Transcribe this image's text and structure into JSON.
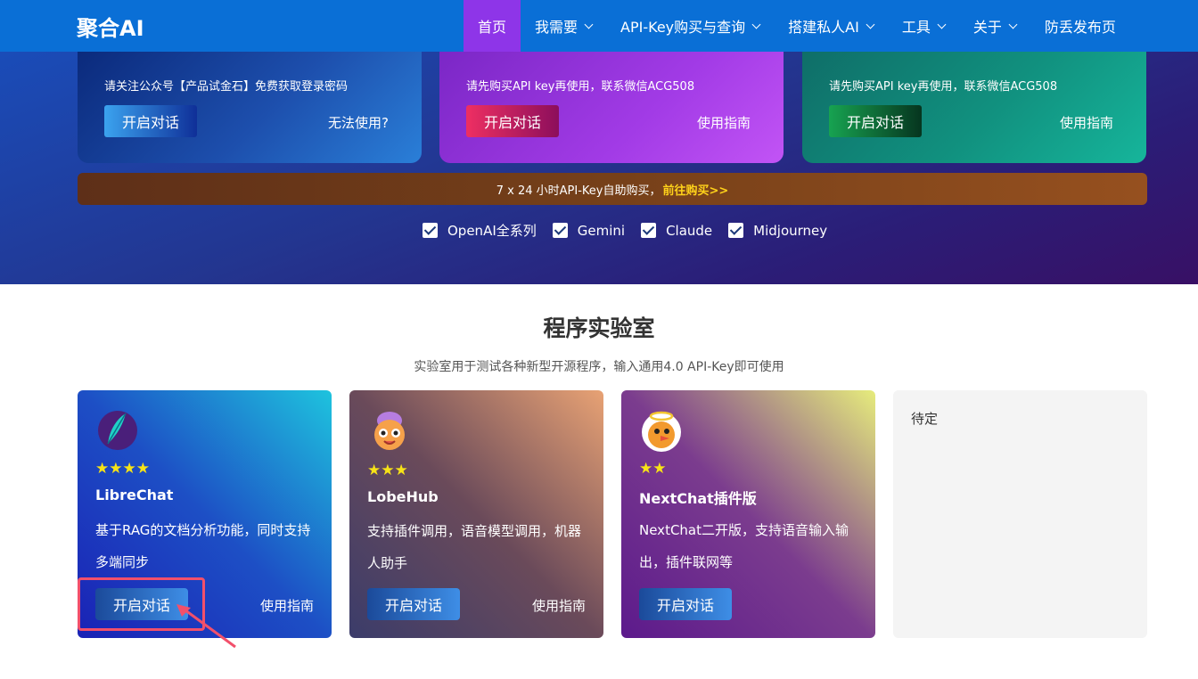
{
  "nav": {
    "brand": "聚合AI",
    "items": [
      {
        "label": "首页"
      },
      {
        "label": "我需要"
      },
      {
        "label": "API-Key购买与查询"
      },
      {
        "label": "搭建私人AI"
      },
      {
        "label": "工具"
      },
      {
        "label": "关于"
      },
      {
        "label": "防丢发布页"
      }
    ]
  },
  "top_cards": [
    {
      "message": "请关注公众号【产品试金石】免费获取登录密码",
      "button": "开启对话",
      "link": "无法使用?"
    },
    {
      "message": "请先购买API key再使用，联系微信ACG508",
      "button": "开启对话",
      "link": "使用指南"
    },
    {
      "message": "请先购买API key再使用，联系微信ACG508",
      "button": "开启对话",
      "link": "使用指南"
    }
  ],
  "banner": {
    "text": "7 x 24 小时API-Key自助购买，",
    "link": "前往购买>>"
  },
  "checks": [
    {
      "label": "OpenAI全系列",
      "checked": true
    },
    {
      "label": "Gemini",
      "checked": true
    },
    {
      "label": "Claude",
      "checked": true
    },
    {
      "label": "Midjourney",
      "checked": true
    }
  ],
  "lab": {
    "title": "程序实验室",
    "subtitle": "实验室用于测试各种新型开源程序，输入通用4.0 API-Key即可使用",
    "cards": [
      {
        "stars": "★★★★",
        "rating": 4,
        "name": "LibreChat",
        "desc": "基于RAG的文档分析功能，同时支持多端同步",
        "button": "开启对话",
        "link": "使用指南",
        "logo": "feather-logo"
      },
      {
        "stars": "★★★",
        "rating": 3,
        "name": "LobeHub",
        "desc": "支持插件调用，语音模型调用，机器人助手",
        "button": "开启对话",
        "link": "使用指南",
        "logo": "lobe-logo"
      },
      {
        "stars": "★★",
        "rating": 2,
        "name": "NextChat插件版",
        "desc": "NextChat二开版，支持语音输入输出，插件联网等",
        "button": "开启对话",
        "logo": "angel-bird-logo"
      }
    ],
    "placeholder": "待定"
  },
  "colors": {
    "nav": "#0a6fd6",
    "nav_active": "#8e35e8",
    "annotation": "#f2506b",
    "star": "#f7e317",
    "banner_link": "#ffd21a"
  }
}
